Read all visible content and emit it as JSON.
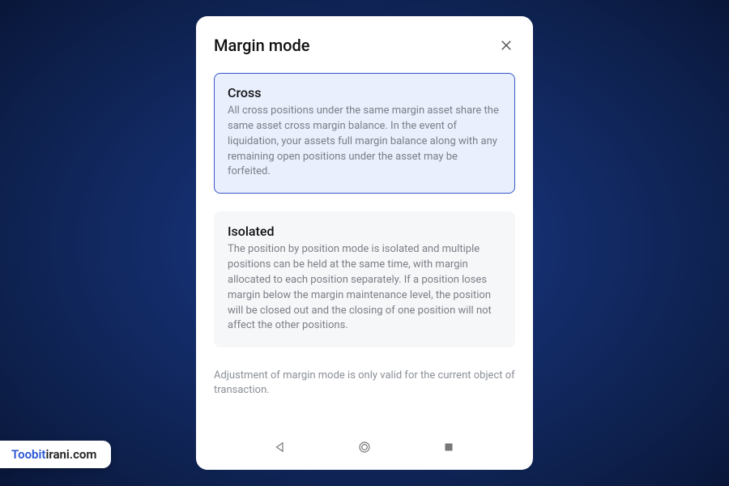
{
  "modal": {
    "title": "Margin mode",
    "options": [
      {
        "title": "Cross",
        "desc": "All cross positions under the same margin asset share the same asset cross margin balance. In the event of liquidation, your assets full margin balance along with any remaining open positions under the asset may be forfeited."
      },
      {
        "title": "Isolated",
        "desc": "The position by position mode is isolated and multiple positions can be held at the same time, with margin allocated to each position separately. If a position loses margin below the margin maintenance level, the position will be closed out and the closing of one position will not affect the other positions."
      }
    ],
    "footnote": "Adjustment of margin mode is only valid for the current object of transaction."
  },
  "watermark": {
    "accent": "Toobit",
    "rest": "irani.com"
  }
}
